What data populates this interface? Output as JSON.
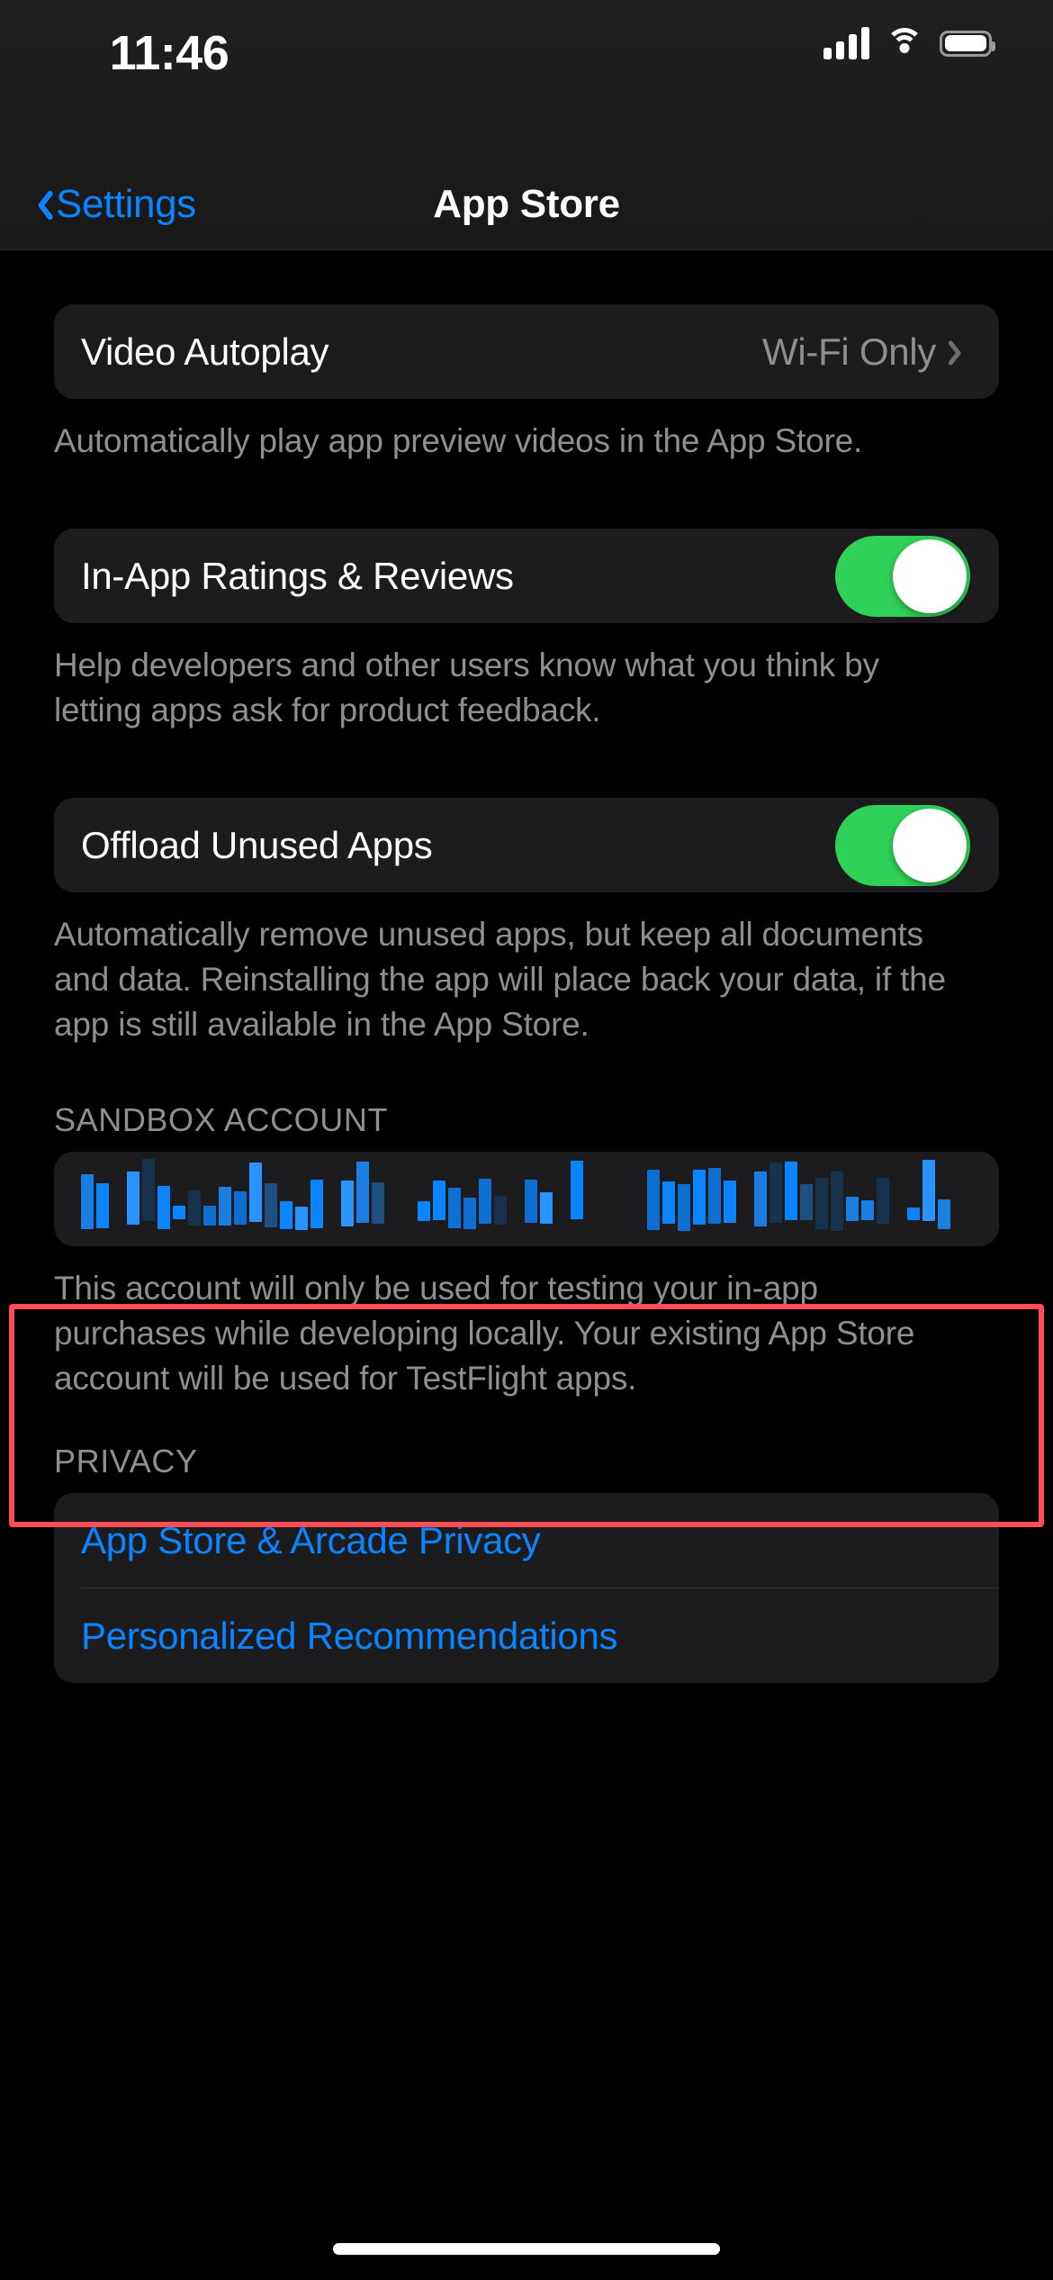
{
  "status_bar": {
    "time": "11:46",
    "cellular_icon": "cellular-bars-icon",
    "wifi_icon": "wifi-icon",
    "battery_icon": "battery-icon"
  },
  "nav_bar": {
    "back_label": "Settings",
    "back_icon": "chevron-left-icon",
    "title": "App Store"
  },
  "sections": {
    "video_autoplay": {
      "label": "Video Autoplay",
      "value": "Wi-Fi Only",
      "disclosure_icon": "chevron-right-icon",
      "footer": "Automatically play app preview videos in the App Store."
    },
    "in_app_ratings": {
      "label": "In-App Ratings & Reviews",
      "toggle_state": "on",
      "footer": "Help developers and other users know what you think by letting apps ask for product feedback."
    },
    "offload_unused_apps": {
      "label": "Offload Unused Apps",
      "toggle_state": "on",
      "footer": "Automatically remove unused apps, but keep all documents and data. Reinstalling the app will place back your data, if the app is still available in the App Store."
    },
    "sandbox_account": {
      "header": "SANDBOX ACCOUNT",
      "value_redacted": true,
      "value_placeholder": "",
      "footer": "This account will only be used for testing your in-app purchases while developing locally. Your existing App Store account will be used for TestFlight apps."
    },
    "privacy": {
      "header": "PRIVACY",
      "items": [
        {
          "label": "App Store & Arcade Privacy"
        },
        {
          "label": "Personalized Recommendations"
        }
      ]
    }
  },
  "annotation": {
    "highlight_color": "#ff4d55",
    "target": "sandbox-account-section"
  },
  "colors": {
    "background": "#000000",
    "card": "#1c1c1e",
    "accent_blue": "#0a84ff",
    "toggle_on_green": "#30d158",
    "secondary_text": "#8e8e93",
    "separator": "#38383a"
  },
  "home_indicator": "home-indicator"
}
